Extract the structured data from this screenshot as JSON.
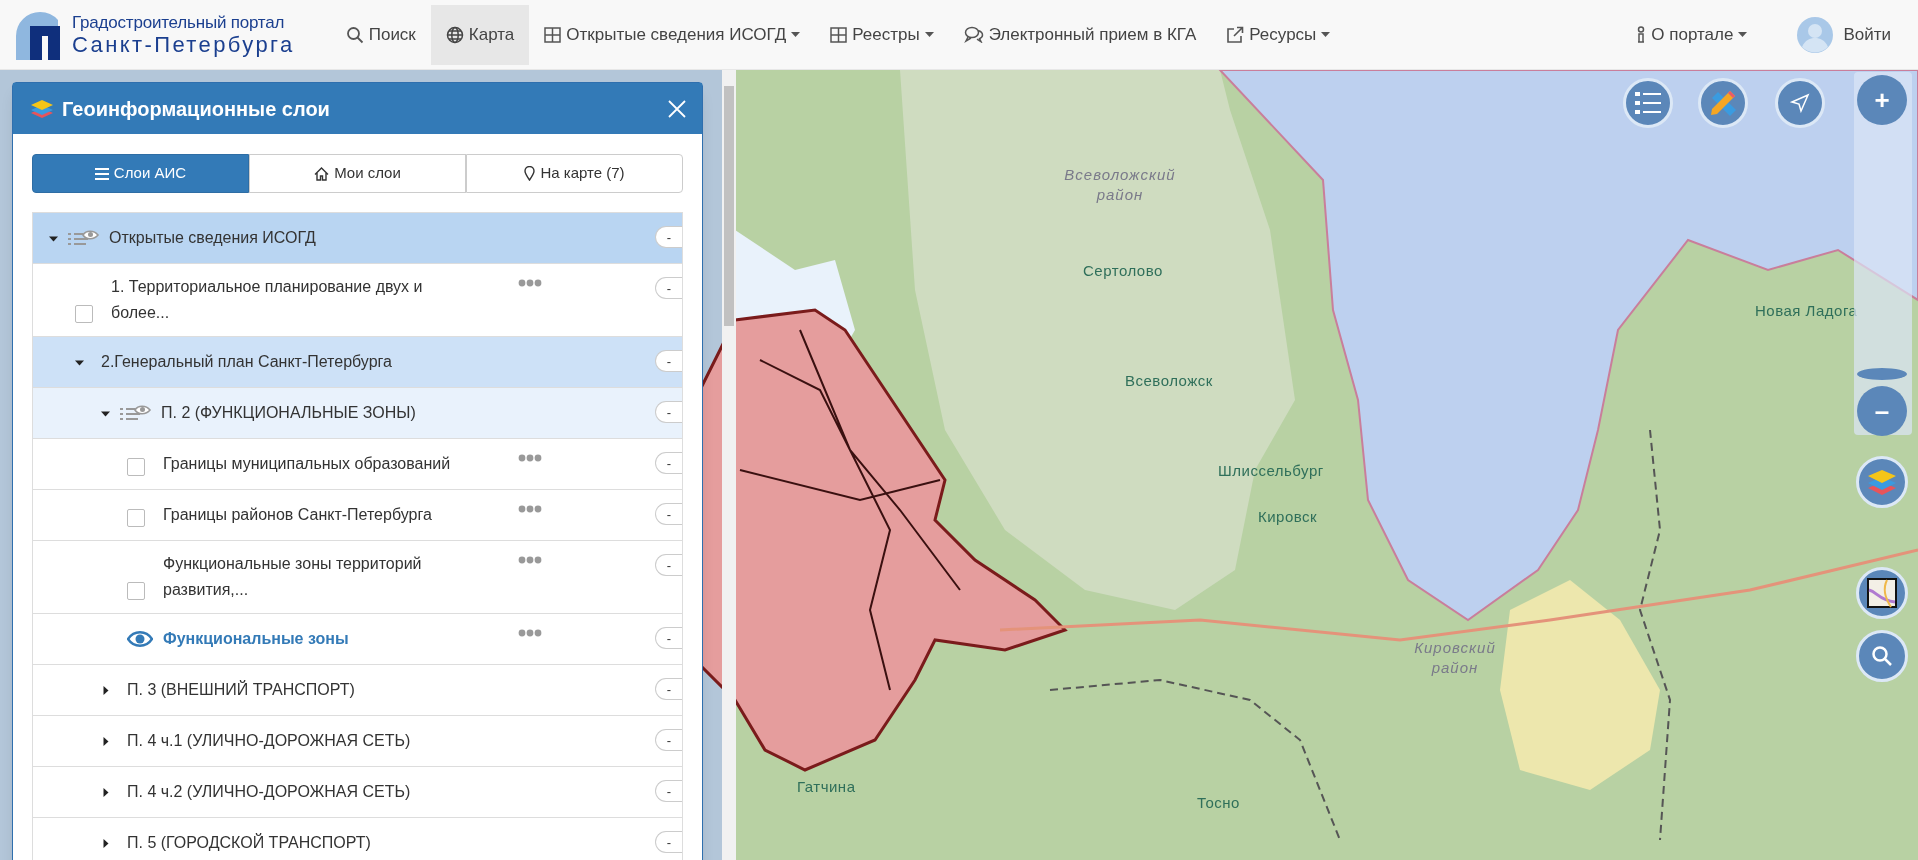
{
  "header": {
    "logo": {
      "line_1": "Градостроительный портал",
      "line_2": "Санкт-Петербурга"
    },
    "nav": [
      {
        "label": "Поиск",
        "dropdown": false,
        "selected": false
      },
      {
        "label": "Карта",
        "dropdown": false,
        "selected": true
      },
      {
        "label": "Открытые сведения ИСОГД",
        "dropdown": true,
        "selected": false
      },
      {
        "label": "Реестры",
        "dropdown": true,
        "selected": false
      },
      {
        "label": "Электронный прием в КГА",
        "dropdown": false,
        "selected": false
      },
      {
        "label": "Ресурсы",
        "dropdown": true,
        "selected": false
      }
    ],
    "right_nav": [
      {
        "label": "О портале",
        "dropdown": true,
        "selected": false
      },
      {
        "label": "Войти",
        "dropdown": false,
        "selected": false
      }
    ]
  },
  "panel": {
    "title": "Геоинформационные слои",
    "tabs": [
      {
        "label": "Слои АИС",
        "selected": true
      },
      {
        "label": "Мои слои",
        "selected": false
      },
      {
        "label": "На карте (7)",
        "selected": false
      }
    ],
    "tree": [
      {
        "kind": "group",
        "label": "Открытые сведения ИСОГД",
        "shown": true,
        "expanded": true,
        "toggle": "-",
        "children": [
          {
            "kind": "layer",
            "label": "1. Территориальное планирование двух и более...",
            "visible": false,
            "checked": false,
            "toggle": "-"
          },
          {
            "kind": "group",
            "label": "2.Генеральный план Санкт-Петербурга",
            "shown": false,
            "expanded": true,
            "toggle": "-",
            "children": [
              {
                "kind": "group",
                "label": "П. 2 (ФУНКЦИОНАЛЬНЫЕ ЗОНЫ)",
                "shown": true,
                "expanded": true,
                "toggle": "-",
                "children": [
                  {
                    "kind": "layer",
                    "label": "Границы муниципальных образований",
                    "visible": false,
                    "checked": false,
                    "toggle": "-"
                  },
                  {
                    "kind": "layer",
                    "label": "Границы районов Санкт-Петербурга",
                    "visible": false,
                    "checked": false,
                    "toggle": "-"
                  },
                  {
                    "kind": "layer",
                    "label": "Функциональные зоны территорий развития,...",
                    "visible": false,
                    "checked": false,
                    "toggle": "-"
                  },
                  {
                    "kind": "layer",
                    "label": "Функциональные зоны",
                    "visible": true,
                    "toggle": "-"
                  }
                ]
              },
              {
                "kind": "group",
                "label": "П. 3 (ВНЕШНИЙ ТРАНСПОРТ)",
                "shown": false,
                "expanded": false,
                "toggle": "-"
              },
              {
                "kind": "group",
                "label": "П. 4 ч.1 (УЛИЧНО-ДОРОЖНАЯ СЕТЬ)",
                "shown": false,
                "expanded": false,
                "toggle": "-"
              },
              {
                "kind": "group",
                "label": "П. 4 ч.2 (УЛИЧНО-ДОРОЖНАЯ СЕТЬ)",
                "shown": false,
                "expanded": false,
                "toggle": "-"
              },
              {
                "kind": "group",
                "label": "П. 5 (ГОРОДСКОЙ ТРАНСПОРТ)",
                "shown": false,
                "expanded": false,
                "toggle": "-"
              }
            ]
          }
        ]
      }
    ]
  },
  "map": {
    "labels": [
      {
        "kind": "district",
        "text": "Всеволожский район"
      },
      {
        "kind": "town",
        "text": "Сертолово"
      },
      {
        "kind": "town",
        "text": "Всеволожск"
      },
      {
        "kind": "town",
        "text": "Шлиссельбург"
      },
      {
        "kind": "town",
        "text": "Кировск"
      },
      {
        "kind": "district",
        "text": "Кировский район"
      },
      {
        "kind": "town",
        "text": "Гатчина"
      },
      {
        "kind": "town",
        "text": "Тосно"
      },
      {
        "kind": "town",
        "text": "Новая Ладога"
      }
    ],
    "zoom_in": "+",
    "zoom_out": "–"
  }
}
